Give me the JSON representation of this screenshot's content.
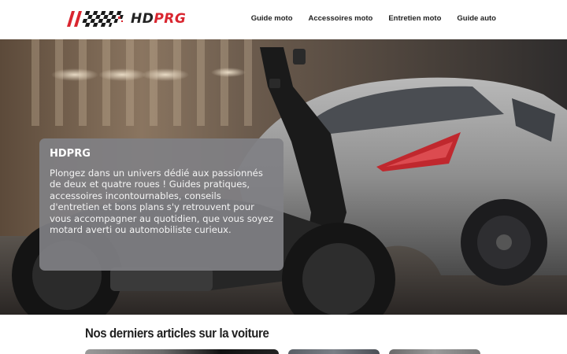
{
  "brand": {
    "hd": "HD",
    "prg": "PRG",
    "accent": "#d9252f"
  },
  "nav": {
    "items": [
      {
        "label": "Guide moto"
      },
      {
        "label": "Accessoires moto"
      },
      {
        "label": "Entretien moto"
      },
      {
        "label": "Guide auto"
      }
    ]
  },
  "hero": {
    "title": "HDPRG",
    "text": "Plongez dans un univers dédié aux passionnés de deux et quatre roues ! Guides pratiques, accessoires incontournables, conseils d'entretien et bons plans s'y retrouvent pour vous accompagner au quotidien, que vous soyez motard averti ou automobiliste curieux."
  },
  "articles": {
    "title": "Nos derniers articles sur la voiture"
  }
}
